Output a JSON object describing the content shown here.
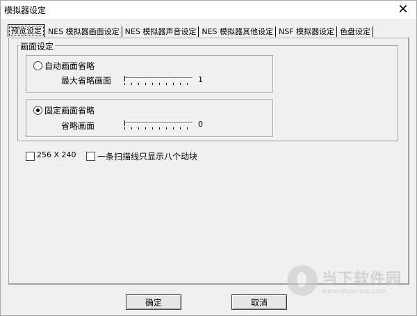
{
  "window": {
    "title": "模拟器设定",
    "close_glyph": "✕"
  },
  "tabs": [
    {
      "label": "预览设定"
    },
    {
      "label": "NES 模拟器画面设定"
    },
    {
      "label": "NES 模拟器声音设定"
    },
    {
      "label": "NES 模拟器其他设定"
    },
    {
      "label": "NSF 模拟器设定"
    },
    {
      "label": "色盘设定"
    }
  ],
  "screen_group": {
    "title": "画面设定",
    "auto_skip": {
      "label": "自动画面省略",
      "checked": false,
      "slider_label": "最大省略画面",
      "value": "1"
    },
    "fixed_skip": {
      "label": "固定画面省略",
      "checked": true,
      "slider_label": "省略画面",
      "value": "0"
    }
  },
  "options": {
    "res_label": "256 X 240",
    "sprite_label": "一条扫描线只显示八个动块"
  },
  "buttons": {
    "ok": "确定",
    "cancel": "取消"
  },
  "watermark": {
    "cn": "当下软件园",
    "url": "www.downxia.com"
  }
}
